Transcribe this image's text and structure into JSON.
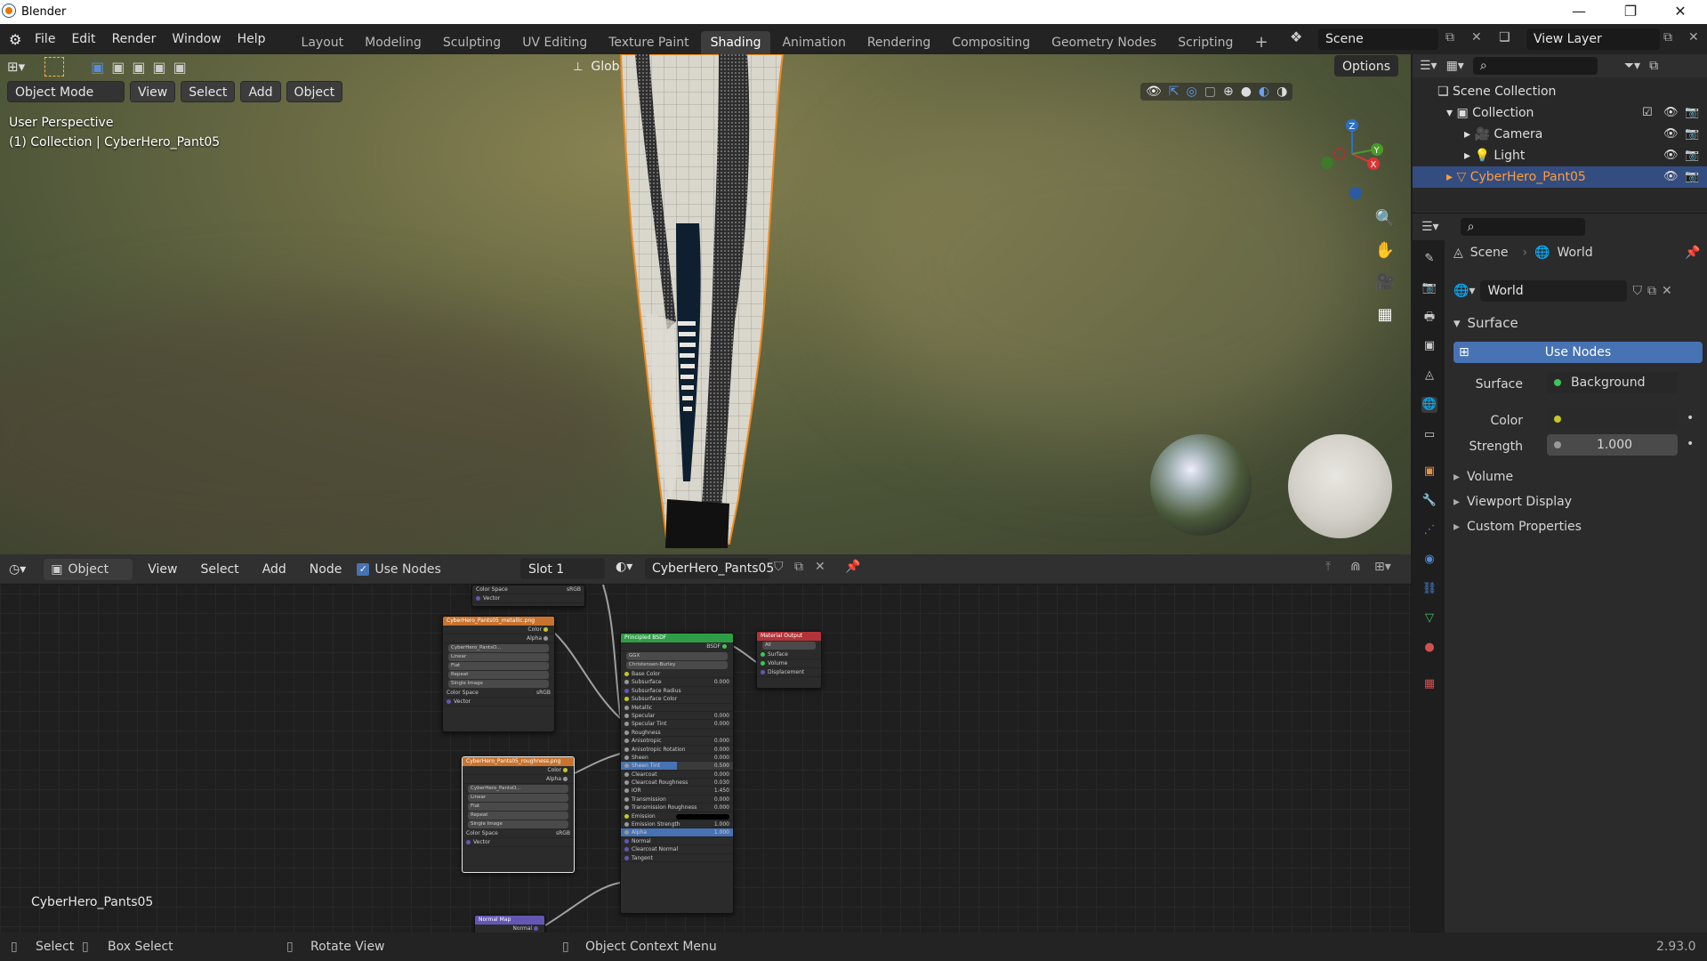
{
  "window": {
    "title": "Blender",
    "controls": [
      "—",
      "❐",
      "✕"
    ]
  },
  "menu": [
    "File",
    "Edit",
    "Render",
    "Window",
    "Help"
  ],
  "workspaces": [
    "Layout",
    "Modeling",
    "Sculpting",
    "UV Editing",
    "Texture Paint",
    "Shading",
    "Animation",
    "Rendering",
    "Compositing",
    "Geometry Nodes",
    "Scripting"
  ],
  "active_workspace": "Shading",
  "scene": {
    "name": "Scene",
    "view_layer": "View Layer"
  },
  "viewport": {
    "mode": "Object Mode",
    "menus": [
      "View",
      "Select",
      "Add",
      "Object"
    ],
    "transform_orientation": "Global",
    "options_label": "Options",
    "perspective_label": "User Perspective",
    "collection_label": "(1) Collection | CyberHero_Pant05",
    "gizmo_axes": {
      "z": "Z",
      "y": "Y",
      "x": "X"
    }
  },
  "node_editor": {
    "editor_type": "Object",
    "menus": [
      "View",
      "Select",
      "Add",
      "Node"
    ],
    "use_nodes_label": "Use Nodes",
    "use_nodes_checked": true,
    "slot": "Slot 1",
    "material": "CyberHero_Pants05",
    "material_name_label": "CyberHero_Pants05",
    "nodes": {
      "img_top": {
        "rows": [
          "Color Space",
          "Vector"
        ],
        "colorspace": "sRGB"
      },
      "metallic": {
        "title": "CyberHero_Pants05_metallic.png",
        "outputs": [
          "Color",
          "Alpha"
        ],
        "image": "CyberHero_PantsO...",
        "options": [
          "Linear",
          "Flat",
          "Repeat",
          "Single Image"
        ],
        "colorspace_label": "Color Space",
        "colorspace": "sRGB",
        "vector": "Vector"
      },
      "roughness": {
        "title": "CyberHero_Pants05_roughness.png",
        "outputs": [
          "Color",
          "Alpha"
        ],
        "image": "CyberHero_PantsO...",
        "options": [
          "Linear",
          "Flat",
          "Repeat",
          "Single Image"
        ],
        "colorspace_label": "Color Space",
        "colorspace": "sRGB",
        "vector": "Vector"
      },
      "bsdf": {
        "title": "Principled BSDF",
        "output": "BSDF",
        "dropdowns": [
          "GGX",
          "Christensen-Burley"
        ],
        "inputs": [
          {
            "label": "Base Color",
            "value": ""
          },
          {
            "label": "Subsurface",
            "value": "0.000"
          },
          {
            "label": "Subsurface Radius",
            "value": ""
          },
          {
            "label": "Subsurface Color",
            "value": ""
          },
          {
            "label": "Metallic",
            "value": ""
          },
          {
            "label": "Specular",
            "value": "0.000"
          },
          {
            "label": "Specular Tint",
            "value": "0.000"
          },
          {
            "label": "Roughness",
            "value": ""
          },
          {
            "label": "Anisotropic",
            "value": "0.000"
          },
          {
            "label": "Anisotropic Rotation",
            "value": "0.000"
          },
          {
            "label": "Sheen",
            "value": "0.000"
          },
          {
            "label": "Sheen Tint",
            "value": "0.500"
          },
          {
            "label": "Clearcoat",
            "value": "0.000"
          },
          {
            "label": "Clearcoat Roughness",
            "value": "0.030"
          },
          {
            "label": "IOR",
            "value": "1.450"
          },
          {
            "label": "Transmission",
            "value": "0.000"
          },
          {
            "label": "Transmission Roughness",
            "value": "0.000"
          },
          {
            "label": "Emission",
            "value": ""
          },
          {
            "label": "Emission Strength",
            "value": "1.000"
          },
          {
            "label": "Alpha",
            "value": "1.000"
          },
          {
            "label": "Normal",
            "value": ""
          },
          {
            "label": "Clearcoat Normal",
            "value": ""
          },
          {
            "label": "Tangent",
            "value": ""
          }
        ]
      },
      "output": {
        "title": "Material Output",
        "target": "All",
        "inputs": [
          "Surface",
          "Volume",
          "Displacement"
        ]
      },
      "normal": {
        "title": "Normal Map",
        "output": "Normal"
      }
    }
  },
  "outliner": {
    "root": "Scene Collection",
    "items": [
      {
        "label": "Collection",
        "icon": "collection-icon"
      },
      {
        "label": "Camera",
        "icon": "camera-icon"
      },
      {
        "label": "Light",
        "icon": "light-icon"
      },
      {
        "label": "CyberHero_Pant05",
        "icon": "mesh-icon",
        "selected": true
      }
    ]
  },
  "properties": {
    "breadcrumb": [
      "Scene",
      "World"
    ],
    "datablock": "World",
    "surface_panel": "Surface",
    "use_nodes_button": "Use Nodes",
    "surface_label": "Surface",
    "surface_value": "Background",
    "color_label": "Color",
    "strength_label": "Strength",
    "strength_value": "1.000",
    "collapsed_panels": [
      "Volume",
      "Viewport Display",
      "Custom Properties"
    ]
  },
  "statusbar": {
    "items": [
      "Select",
      "Box Select",
      "Rotate View",
      "Object Context Menu"
    ],
    "version": "2.93.0"
  },
  "colors": {
    "accent_blue": "#4772b3",
    "selection_orange": "#ff9c3a",
    "node_image": "#c8742f",
    "node_bsdf": "#2e9e46",
    "node_output": "#b3333a",
    "node_vector": "#6457b3"
  }
}
